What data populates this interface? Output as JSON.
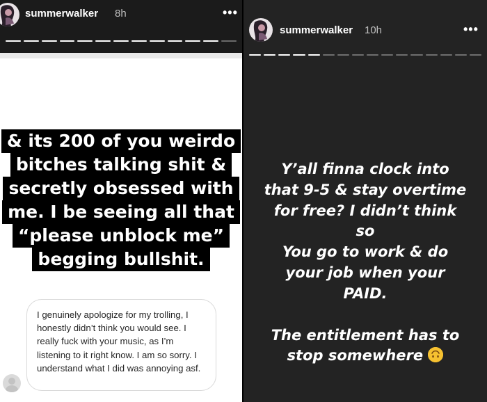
{
  "left_story": {
    "username": "summerwalker",
    "time": "8h",
    "more_label": "•••",
    "caption_lines": [
      "& its 200 of you weirdo",
      "bitches talking shit &",
      "secretly obsessed with",
      "me. I be seeing all that",
      "“please unblock me”",
      "begging bullshit."
    ],
    "dm_message": "I genuinely apologize for my trolling, I honestly didn’t think you would see. I really fuck with your music, as I’m listening to it right know. I am so sorry. I understand what I did was annoying asf."
  },
  "right_story": {
    "username": "summerwalker",
    "time": "10h",
    "more_label": "•••",
    "lines": [
      "Y’all finna clock into",
      "that 9-5 & stay overtime",
      "for free? I didn’t think",
      "so",
      "You go to work & do",
      "your job when your",
      "PAID."
    ],
    "closing_lines": [
      "The entitlement has to",
      "stop somewhere"
    ],
    "emoji": "upside-down-face"
  },
  "colors": {
    "right_background": "#232323",
    "caption_background": "#000000",
    "emoji_yellow": "#f6c130"
  }
}
